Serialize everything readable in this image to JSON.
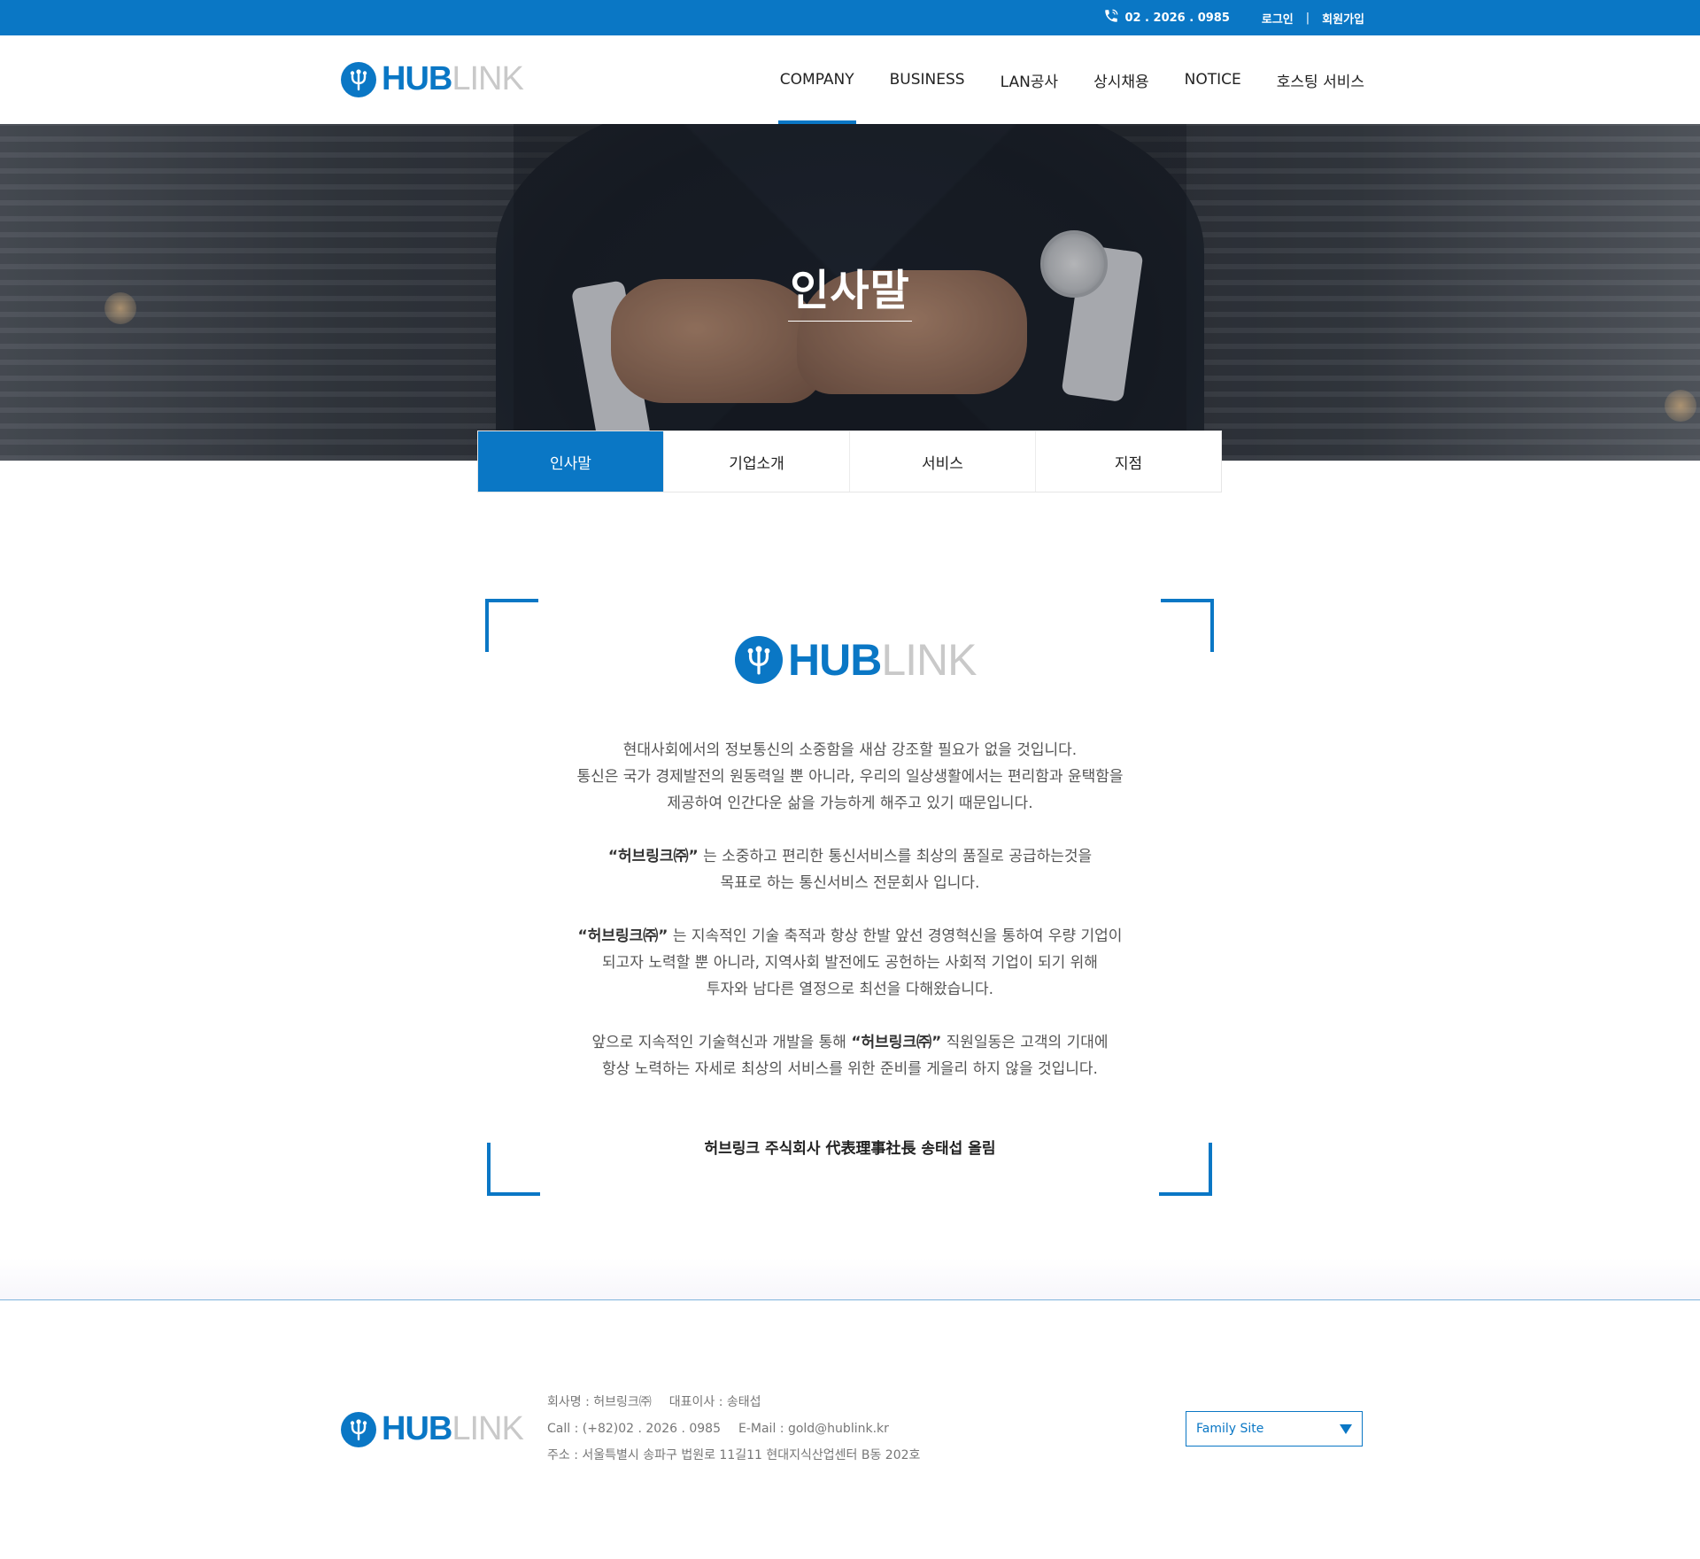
{
  "topbar": {
    "phone": "02 . 2026 . 0985",
    "login": "로그인",
    "separator": "|",
    "signup": "회원가입"
  },
  "brand": {
    "hub": "HUB",
    "link": "LINK",
    "color": "#0a77c5"
  },
  "nav": {
    "items": [
      "COMPANY",
      "BUSINESS",
      "LAN공사",
      "상시채용",
      "NOTICE",
      "호스팅 서비스"
    ],
    "active": "COMPANY"
  },
  "hero": {
    "title": "인사말"
  },
  "tabs": {
    "items": [
      "인사말",
      "기업소개",
      "서비스",
      "지점"
    ],
    "active": "인사말"
  },
  "greeting": {
    "p1": [
      "현대사회에서의 정보통신의 소중함을 새삼 강조할 필요가 없을 것입니다.",
      "통신은 국가 경제발전의 원동력일 뿐 아니라, 우리의 일상생활에서는 편리함과 윤택함을",
      "제공하여 인간다운 삶을 가능하게 해주고 있기 때문입니다."
    ],
    "p2_company": "“허브링크㈜”",
    "p2": [
      "는 소중하고 편리한 통신서비스를 최상의 품질로 공급하는것을",
      "목표로 하는 통신서비스 전문회사 입니다."
    ],
    "p3_company": "“허브링크㈜”",
    "p3": [
      "는 지속적인 기술 축적과 항상 한발 앞선 경영혁신을 통하여 우량 기업이",
      "되고자 노력할 뿐 아니라, 지역사회 발전에도 공헌하는 사회적 기업이 되기 위해",
      "투자와 남다른 열정으로 최선을 다해왔습니다."
    ],
    "p4_pre": "앞으로 지속적인 기술혁신과 개발을 통해",
    "p4_company": "“허브링크㈜”",
    "p4_post": "직원일동은 고객의 기대에",
    "p4_line2": "항상 노력하는 자세로 최상의 서비스를 위한 준비를 게을리 하지 않을 것입니다.",
    "signature": "허브링크 주식회사 代表理事社長 송태섭 올림"
  },
  "footer": {
    "company": "회사명 : 허브링크㈜",
    "ceo": "대표이사 : 송태섭",
    "call": "Call :  (+82)02 . 2026 . 0985",
    "email": "E-Mail : gold@hublink.kr",
    "address": "주소 : 서울특별시 송파구 법원로 11길11 현대지식산업센터 B동 202호",
    "family_site": "Family Site"
  }
}
